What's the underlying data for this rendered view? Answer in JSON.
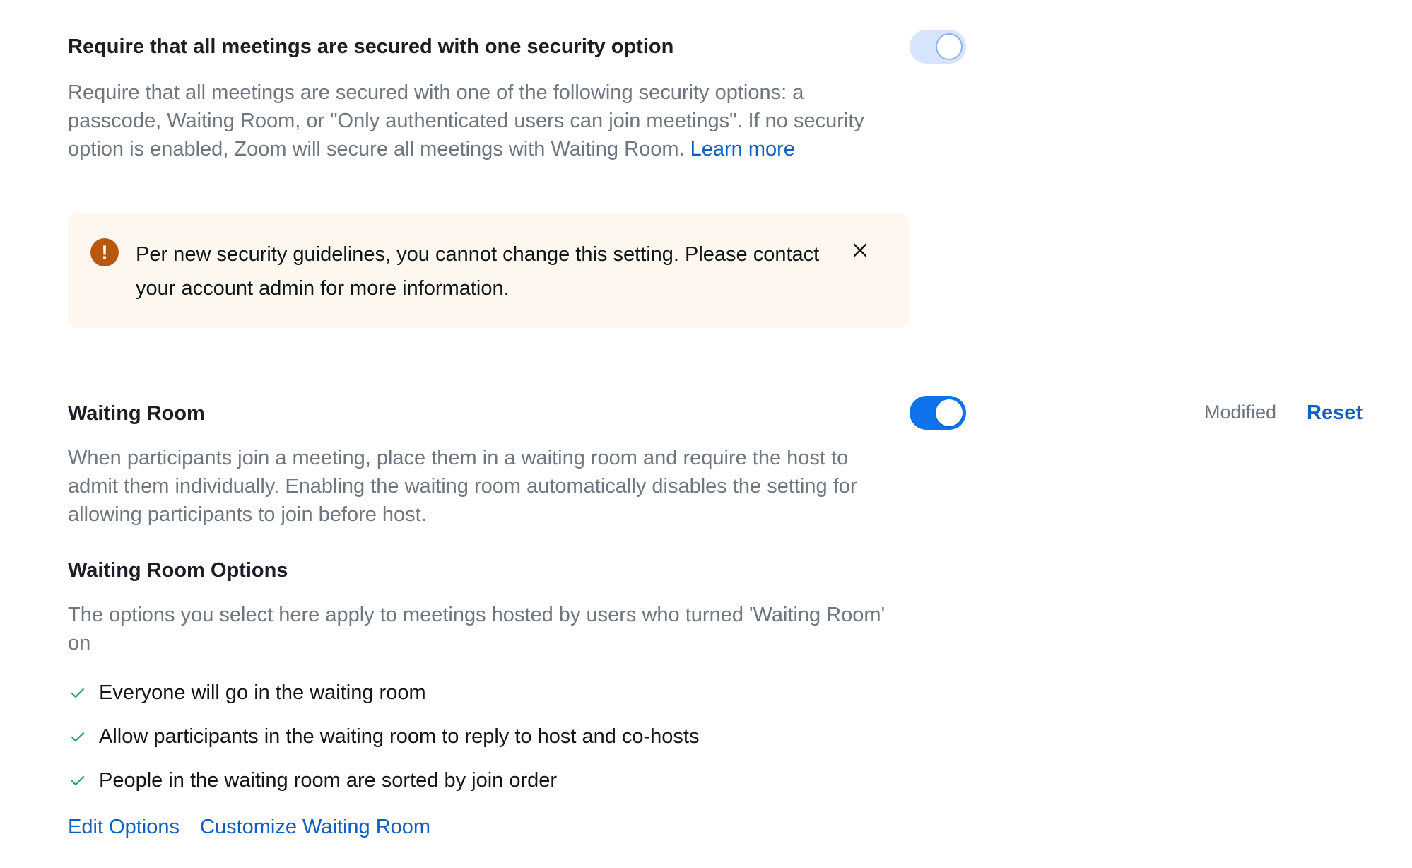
{
  "secure_setting": {
    "title": "Require that all meetings are secured with one security option",
    "description": "Require that all meetings are secured with one of the following security options: a passcode, Waiting Room, or \"Only authenticated users can join meetings\". If no security option is enabled, Zoom will secure all meetings with Waiting Room.",
    "learn_more": "Learn more",
    "toggle_state": "on-locked",
    "alert": {
      "icon": "exclamation-icon",
      "text": "Per new security guidelines, you cannot change this setting. Please contact your account admin for more information.",
      "close_icon": "close-icon"
    }
  },
  "waiting_room": {
    "title": "Waiting Room",
    "toggle_state": "on",
    "status": "Modified",
    "reset_label": "Reset",
    "description": "When participants join a meeting, place them in a waiting room and require the host to admit them individually. Enabling the waiting room automatically disables the setting for allowing participants to join before host.",
    "options_title": "Waiting Room Options",
    "options_description": "The options you select here apply to meetings hosted by users who turned 'Waiting Room' on",
    "options": [
      "Everyone will go in the waiting room",
      "Allow participants in the waiting room to reply to host and co-hosts",
      "People in the waiting room are sorted by join order"
    ],
    "edit_options_label": "Edit Options",
    "customize_label": "Customize Waiting Room"
  },
  "colors": {
    "accent": "#0e72ed",
    "link": "#0e5fbf",
    "alert_bg": "#fef7f0",
    "alert_icon": "#b9570b",
    "check": "#23a85a"
  }
}
